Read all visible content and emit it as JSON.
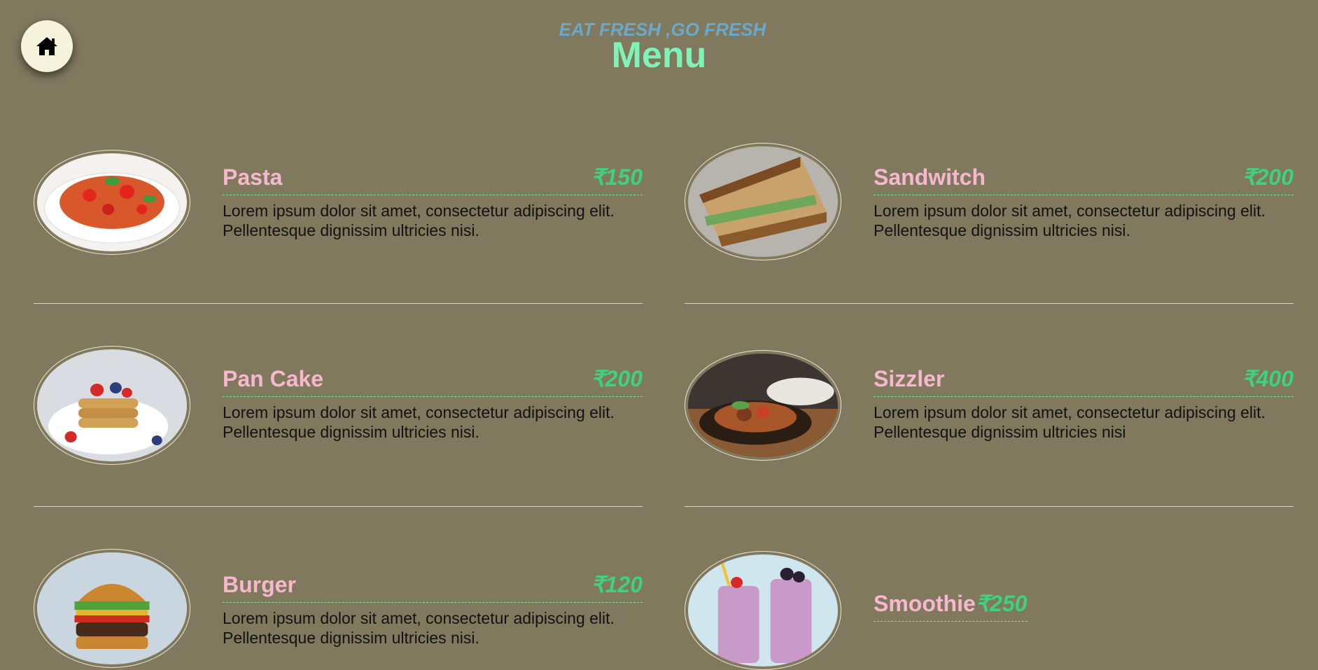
{
  "header": {
    "tagline": "EAT FRESH ,GO FRESH",
    "title": "Menu"
  },
  "nav": {
    "home_icon": "home-icon"
  },
  "colors": {
    "background": "#80795e",
    "name": "#f7b8cf",
    "price": "#3ed17f",
    "title": "#7ff2b8",
    "tagline": "#6aa9c9"
  },
  "menu": [
    {
      "name": "Pasta",
      "price": "₹150",
      "desc_line1": "Lorem ipsum dolor sit amet, consectetur adipiscing elit.",
      "desc_line2": "Pellentesque dignissim ultricies nisi."
    },
    {
      "name": "Sandwitch",
      "price": "₹200",
      "desc_line1": "Lorem ipsum dolor sit amet, consectetur adipiscing elit.",
      "desc_line2": "Pellentesque dignissim ultricies nisi."
    },
    {
      "name": "Pan Cake",
      "price": "₹200",
      "desc_line1": "Lorem ipsum dolor sit amet, consectetur adipiscing elit.",
      "desc_line2": "Pellentesque dignissim ultricies nisi."
    },
    {
      "name": "Sizzler",
      "price": "₹400",
      "desc_line1": "Lorem ipsum dolor sit amet, consectetur adipiscing elit.",
      "desc_line2": "Pellentesque dignissim ultricies nisi"
    },
    {
      "name": "Burger",
      "price": "₹120",
      "desc_line1": "Lorem ipsum dolor sit amet, consectetur adipiscing elit.",
      "desc_line2": "Pellentesque dignissim ultricies nisi."
    },
    {
      "name": "Smoothie",
      "price": "₹250"
    }
  ]
}
